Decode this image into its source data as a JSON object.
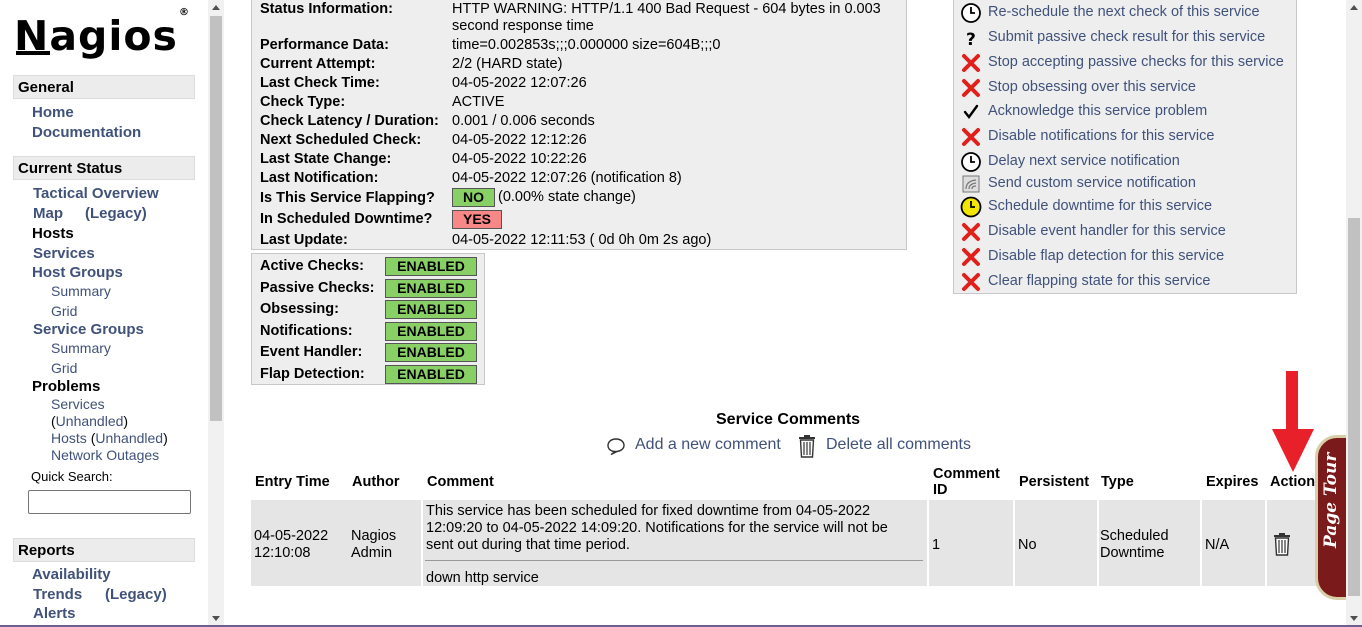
{
  "logo": {
    "text": "Nagios",
    "mark": "®"
  },
  "sidebar": {
    "general": "General",
    "home": "Home",
    "documentation": "Documentation",
    "current_status": "Current Status",
    "tactical_overview": "Tactical Overview",
    "map": "Map",
    "map_legacy": "(Legacy)",
    "hosts": "Hosts",
    "services": "Services",
    "host_groups": "Host Groups",
    "hg_summary": "Summary",
    "hg_grid": "Grid",
    "service_groups": "Service Groups",
    "sg_summary": "Summary",
    "sg_grid": "Grid",
    "problems": "Problems",
    "p_services": "Services",
    "p_unhandled_open": "(",
    "p_unhandled": "Unhandled",
    "p_unhandled_close": ")",
    "p_hosts": "Hosts",
    "p_hosts_unhandled": "Unhandled",
    "p_network_outages": "Network Outages",
    "quick_search_label": "Quick Search:",
    "quick_search_value": "",
    "reports": "Reports",
    "availability": "Availability",
    "trends": "Trends",
    "trends_legacy": "(Legacy)",
    "alerts": "Alerts"
  },
  "status": {
    "rows": [
      {
        "label": "Status Information:",
        "value": "HTTP WARNING: HTTP/1.1 400 Bad Request - 604 bytes in 0.003",
        "value2": "second response time"
      },
      {
        "label": "Performance Data:",
        "value": "time=0.002853s;;;0.000000 size=604B;;;0"
      },
      {
        "label": "Current Attempt:",
        "value": "2/2  (HARD state)"
      },
      {
        "label": "Last Check Time:",
        "value": "04-05-2022 12:07:26"
      },
      {
        "label": "Check Type:",
        "value": "ACTIVE"
      },
      {
        "label": "Check Latency / Duration:",
        "value": "0.001 / 0.006 seconds"
      },
      {
        "label": "Next Scheduled Check:",
        "value": "04-05-2022 12:12:26"
      },
      {
        "label": "Last State Change:",
        "value": "04-05-2022 10:22:26"
      },
      {
        "label": "Last Notification:",
        "value": "04-05-2022 12:07:26 (notification 8)"
      },
      {
        "label": "Is This Service Flapping?",
        "value": ""
      },
      {
        "label": "In Scheduled Downtime?",
        "value": ""
      },
      {
        "label": "Last Update:",
        "value": "04-05-2022 12:11:53  ( 0d 0h 0m 2s ago)"
      }
    ],
    "flapping_badge": "NO",
    "flapping_extra": "(0.00% state change)",
    "downtime_badge": "YES",
    "badge_colors": {
      "ok": "#88d066",
      "bad": "#f88888"
    }
  },
  "checks": [
    {
      "label": "Active Checks:",
      "state": "ENABLED"
    },
    {
      "label": "Passive Checks:",
      "state": "ENABLED"
    },
    {
      "label": "Obsessing:",
      "state": "ENABLED"
    },
    {
      "label": "Notifications:",
      "state": "ENABLED"
    },
    {
      "label": "Event Handler:",
      "state": "ENABLED"
    },
    {
      "label": "Flap Detection:",
      "state": "ENABLED"
    }
  ],
  "commands": [
    {
      "icon": "clock-icon",
      "label": "Re-schedule the next check of this service"
    },
    {
      "icon": "question-icon",
      "label": "Submit passive check result for this service"
    },
    {
      "icon": "red-x-icon",
      "label": "Stop accepting passive checks for this service"
    },
    {
      "icon": "red-x-icon",
      "label": "Stop obsessing over this service"
    },
    {
      "icon": "checkmark-icon",
      "label": "Acknowledge this service problem"
    },
    {
      "icon": "red-x-icon",
      "label": "Disable notifications for this service"
    },
    {
      "icon": "clock-icon",
      "label": "Delay next service notification"
    },
    {
      "icon": "notification-icon",
      "label": "Send custom service notification"
    },
    {
      "icon": "yellow-clock-icon",
      "label": "Schedule downtime for this service"
    },
    {
      "icon": "red-x-icon",
      "label": "Disable event handler for this service"
    },
    {
      "icon": "red-x-icon",
      "label": "Disable flap detection for this service"
    },
    {
      "icon": "red-x-icon",
      "label": "Clear flapping state for this service"
    }
  ],
  "comments": {
    "title": "Service Comments",
    "add": "Add a new comment",
    "delete_all": "Delete all comments",
    "headers": {
      "entry_time": "Entry Time",
      "author": "Author",
      "comment": "Comment",
      "comment_id_1": "Comment",
      "comment_id_2": "ID",
      "persistent": "Persistent",
      "type": "Type",
      "expires": "Expires",
      "action": "Action"
    },
    "row": {
      "entry_date": "04-05-2022",
      "entry_time": "12:10:08",
      "author_1": "Nagios",
      "author_2": "Admin",
      "comment_1": "This service has been scheduled for fixed downtime from 04-05-2022",
      "comment_2": "12:09:20 to 04-05-2022 14:09:20. Notifications for the service will not be",
      "comment_3": "sent out during that time period.",
      "comment_4": "down http service",
      "id": "1",
      "persistent": "No",
      "type_1": "Scheduled",
      "type_2": "Downtime",
      "expires": "N/A"
    }
  },
  "page_tour": "Page Tour",
  "colors": {
    "link": "#40527a",
    "enabled": "#88d066",
    "annotation_arrow": "#e8202a",
    "page_tour_bg": "#7a1a1a"
  }
}
